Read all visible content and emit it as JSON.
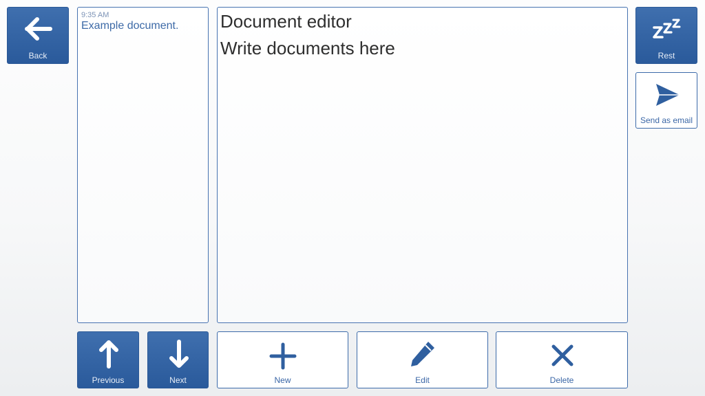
{
  "top_left": {
    "back_label": "Back"
  },
  "top_right": {
    "rest_label": "Rest",
    "send_email_label": "Send as email"
  },
  "document_list": {
    "items": [
      {
        "time": "9:35 AM",
        "title": "Example document."
      }
    ]
  },
  "editor": {
    "lines": [
      "Document editor",
      "Write documents here"
    ]
  },
  "bottom_toolbar": {
    "previous_label": "Previous",
    "next_label": "Next",
    "new_label": "New",
    "edit_label": "Edit",
    "delete_label": "Delete"
  },
  "icons": {
    "back": "arrow-left-icon",
    "rest": "sleep-zzz-icon",
    "send_email": "paper-plane-icon",
    "previous": "arrow-up-icon",
    "next": "arrow-down-icon",
    "new": "plus-icon",
    "edit": "pencil-icon",
    "delete": "close-x-icon"
  },
  "colors": {
    "accent": "#2f5f9f",
    "border": "#4672b0",
    "text_accent": "#3a66a6"
  }
}
